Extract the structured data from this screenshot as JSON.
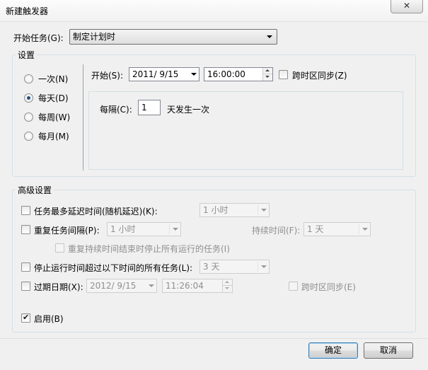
{
  "window": {
    "title": "新建触发器",
    "close_symbol": "✕"
  },
  "begin_task": {
    "label": "开始任务(G):",
    "value": "制定计划时"
  },
  "settings": {
    "group_title": "设置",
    "schedule_options": [
      {
        "label": "一次(N)",
        "checked": false
      },
      {
        "label": "每天(D)",
        "checked": true
      },
      {
        "label": "每周(W)",
        "checked": false
      },
      {
        "label": "每月(M)",
        "checked": false
      }
    ],
    "start_label": "开始(S):",
    "start_date": "2011/  9/15",
    "start_time": "16:00:00",
    "sync_timezone_label": "跨时区同步(Z)",
    "every_label": "每隔(C):",
    "every_value": "1",
    "every_suffix": "天发生一次"
  },
  "advanced": {
    "group_title": "高级设置",
    "delay_label": "任务最多延迟时间(随机延迟)(K):",
    "delay_value": "1 小时",
    "repeat_label": "重复任务间隔(P):",
    "repeat_value": "1 小时",
    "duration_label": "持续时间(F):",
    "duration_value": "1 天",
    "stop_all_label": "重复持续时间结束时停止所有运行的任务(I)",
    "stop_longer_label": "停止运行时间超过以下时间的所有任务(L):",
    "stop_longer_value": "3 天",
    "expire_label": "过期日期(X):",
    "expire_date": "2012/  9/15",
    "expire_time": "11:26:04",
    "expire_sync_label": "跨时区同步(E)",
    "enabled_label": "启用(B)",
    "enabled_checked": true,
    "check_symbol": "✔"
  },
  "buttons": {
    "ok": "确定",
    "cancel": "取消"
  }
}
